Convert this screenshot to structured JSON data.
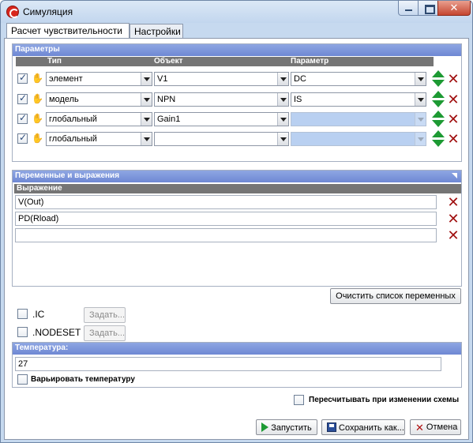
{
  "window": {
    "title": "Симуляция"
  },
  "tabs": [
    {
      "label": "Расчет чувствительности",
      "active": true
    },
    {
      "label": "Настройки",
      "active": false
    }
  ],
  "parameters": {
    "header": "Параметры",
    "columns": {
      "type": "Тип",
      "object": "Объект",
      "parameter": "Параметр"
    },
    "rows": [
      {
        "checked": true,
        "type": "элемент",
        "object": "V1",
        "parameter": "DC",
        "parameter_enabled": true
      },
      {
        "checked": true,
        "type": "модель",
        "object": "NPN",
        "parameter": "IS",
        "parameter_enabled": true
      },
      {
        "checked": true,
        "type": "глобальный",
        "object": "Gain1",
        "parameter": "",
        "parameter_enabled": false
      },
      {
        "checked": true,
        "type": "глобальный",
        "object": "",
        "parameter": "",
        "parameter_enabled": false
      }
    ]
  },
  "variables": {
    "header": "Переменные и выражения",
    "column": "Выражение",
    "items": [
      "V(Out)",
      "PD(Rload)",
      ""
    ],
    "clear_button": "Очистить список переменных"
  },
  "ic": {
    "label": ".IC",
    "checked": false,
    "button": "Задать..."
  },
  "nodeset": {
    "label": ".NODESET",
    "checked": false,
    "button": "Задать..."
  },
  "temperature": {
    "header": "Температура:",
    "value": "27",
    "vary_label": "Варьировать температуру",
    "vary_checked": false
  },
  "recalc": {
    "label": "Пересчитывать при изменении схемы",
    "checked": false
  },
  "buttons": {
    "run": "Запустить",
    "save_as": "Сохранить как...",
    "cancel": "Отмена"
  },
  "colors": {
    "header_blue": "#7890d8",
    "column_gray": "#757575",
    "arrow_green": "#1d9a33",
    "delete_red": "#a01010",
    "disabled_combo": "#b9d0f1"
  }
}
